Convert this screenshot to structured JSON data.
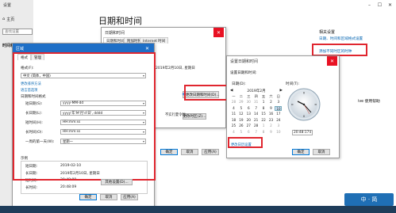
{
  "settings": {
    "title": "设置",
    "home": "主页",
    "search_placeholder": "查找设置",
    "time_language": "时间和语言",
    "page_title": "日期和时间",
    "related_title": "相关设置",
    "related_link1": "日期、时间和区域格式设置",
    "related_link2": "添加不同时区的时钟",
    "feedback": "反馈"
  },
  "datetime_dialog": {
    "title": "日期和时间",
    "tabs": [
      "日期和时间",
      "附加时钟",
      "Internet 时间"
    ],
    "date_text": "2019年2月10日, 星期日",
    "change_button": "更改日期和时间(D)...",
    "tz_button": "更改时区(Z)...",
    "dst_text": "不实行夏令时。",
    "ok": "确定",
    "cancel": "取消",
    "apply": "应用(A)"
  },
  "format_dialog": {
    "title": "区域",
    "tabs": [
      "格式",
      "管理"
    ],
    "format_label": "格式(F):",
    "format_value": "中文 (简体，中国)",
    "link_lang": "更改排序方法",
    "lang_pref": "语言首选项",
    "group_title": "日期和时间格式",
    "fields": [
      {
        "label": "短日期(S):",
        "value": "yyyy-MM-dd"
      },
      {
        "label": "长日期(L):",
        "value": "yyyy'年'M'月'd'日', dddd"
      },
      {
        "label": "短时间(H):",
        "value": "HH:mm:ss"
      },
      {
        "label": "长时间(O):",
        "value": "HH:mm:ss"
      },
      {
        "label": "一周的第一天(W):",
        "value": "星期一"
      }
    ],
    "examples_title": "示例",
    "examples": [
      {
        "label": "短日期:",
        "value": "2019-02-10"
      },
      {
        "label": "长日期:",
        "value": "2019年2月10日, 星期日"
      },
      {
        "label": "短时间:",
        "value": "20:48:09"
      },
      {
        "label": "长时间:",
        "value": "20:48:09"
      }
    ],
    "other_settings": "其他设置(D)...",
    "ok": "确定",
    "cancel": "取消",
    "apply": "应用(A)"
  },
  "set_dialog": {
    "title": "设置日期和时间",
    "prompt": "设置日期和时间:",
    "date_label": "日期(D):",
    "time_label": "时间(T):",
    "month": "2019年2月",
    "weekdays": [
      "一",
      "二",
      "三",
      "四",
      "五",
      "六",
      "日"
    ],
    "days": [
      "28",
      "29",
      "30",
      "31",
      "1",
      "2",
      "3",
      "4",
      "5",
      "6",
      "7",
      "8",
      "9",
      "10",
      "11",
      "12",
      "13",
      "14",
      "15",
      "16",
      "17",
      "18",
      "19",
      "20",
      "21",
      "22",
      "23",
      "24",
      "25",
      "26",
      "27",
      "28",
      "1",
      "2",
      "3",
      "4",
      "5",
      "6",
      "7",
      "8",
      "9",
      "10"
    ],
    "time_value": "20:48:17",
    "change_calendar": "更改日历设置",
    "ok": "确定",
    "cancel": "取消"
  },
  "misc": {
    "side_text": "ive 使用帮助",
    "ime_text": "中 · 简"
  },
  "colors": {
    "highlight": "#e0262f",
    "link": "#0063b1",
    "selected_day": "#cce4f7"
  }
}
